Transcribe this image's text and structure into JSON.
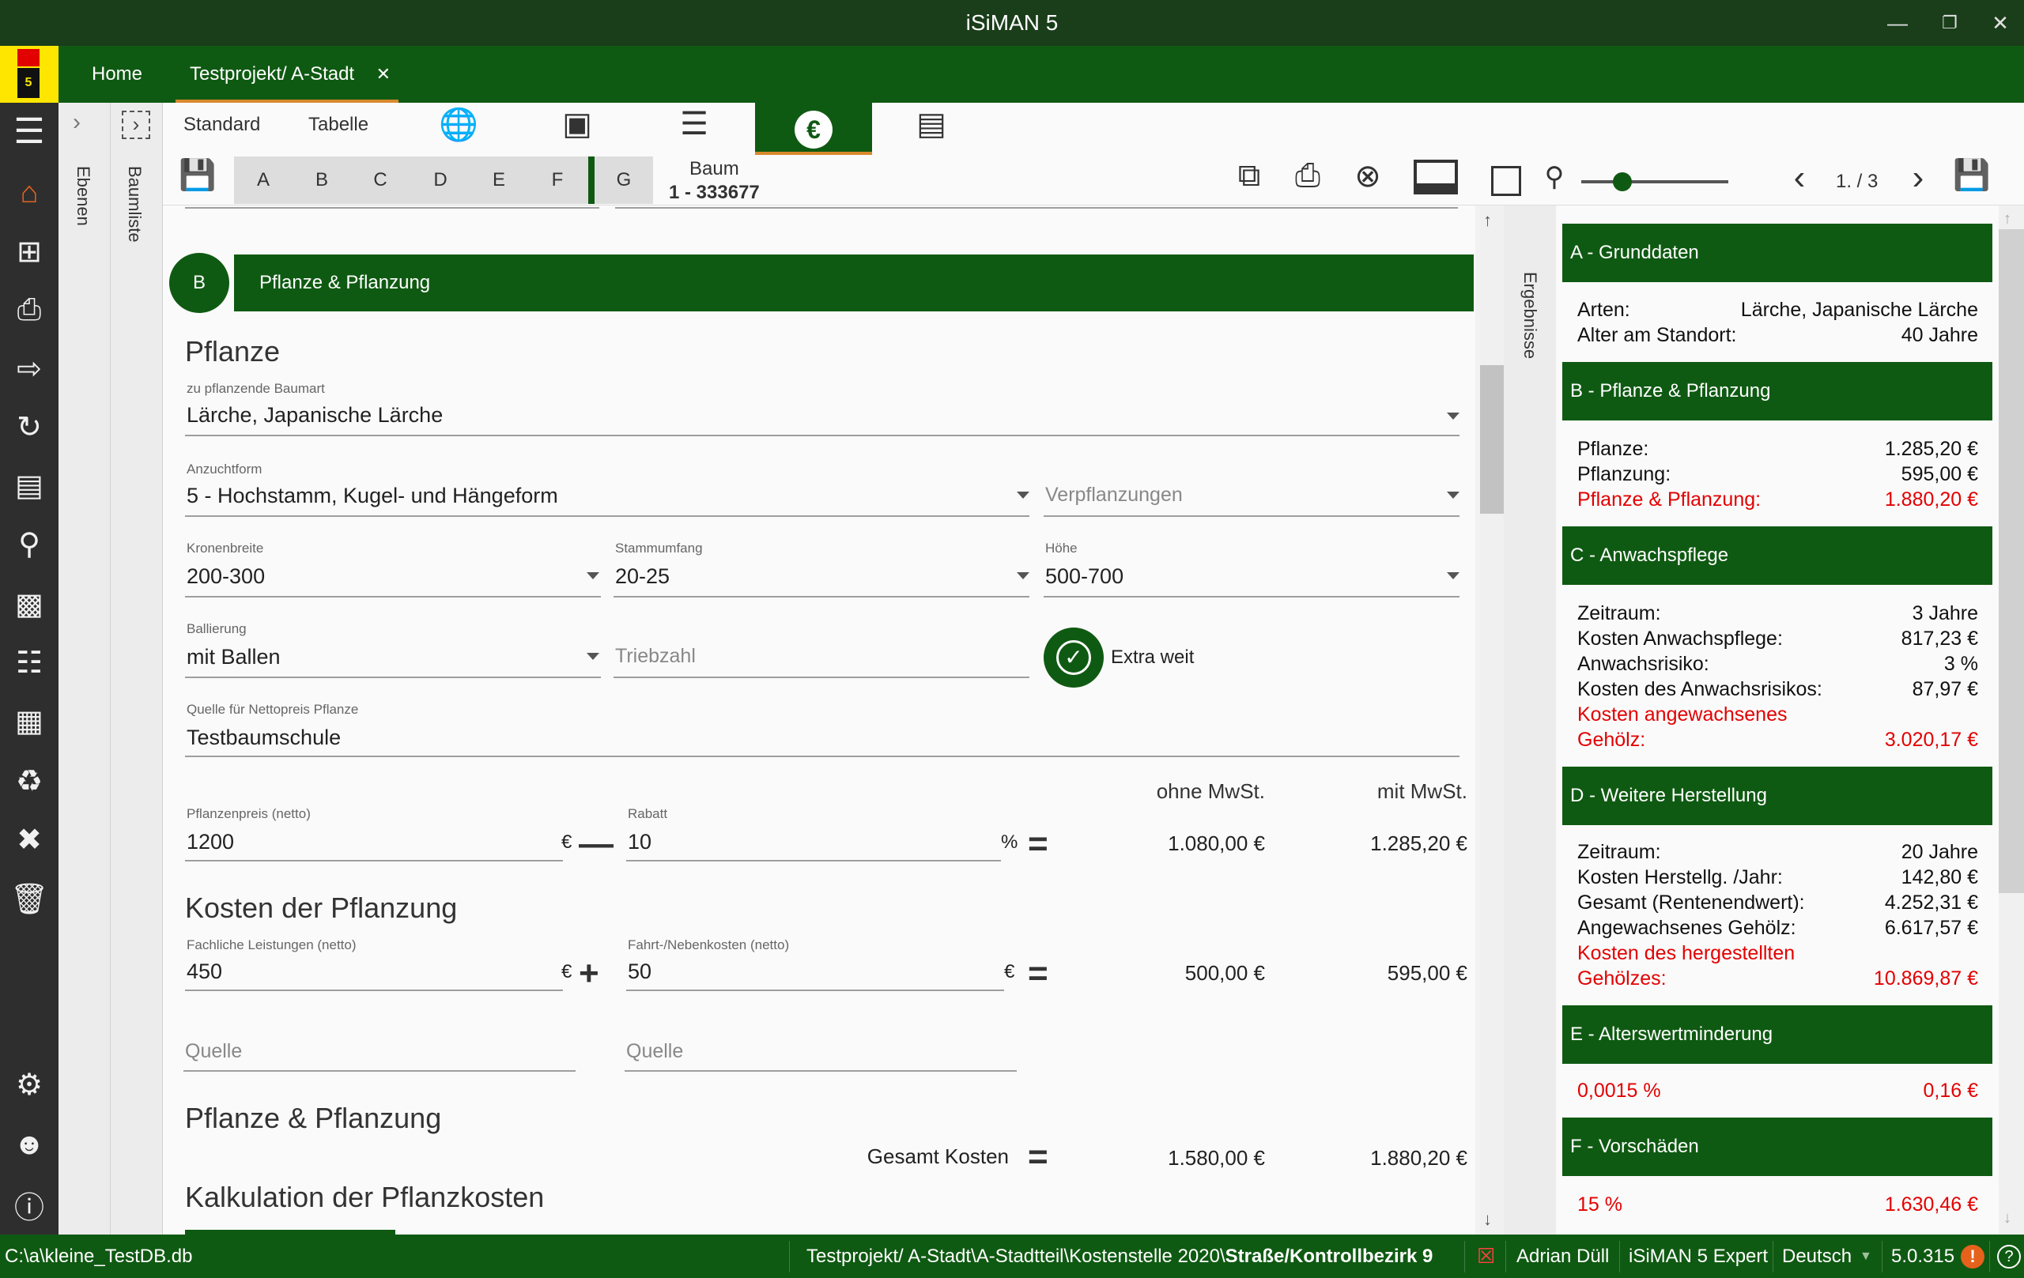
{
  "window": {
    "title": "iSiMAN 5"
  },
  "logo": {
    "text": "5"
  },
  "tabs": [
    {
      "label": "Home"
    },
    {
      "label": "Testprojekt/ A-Stadt"
    }
  ],
  "rails": {
    "ebenen": "Ebenen",
    "baumliste": "Baumliste",
    "ergebnisse": "Ergebnisse"
  },
  "toolbar": {
    "standard": "Standard",
    "tabelle": "Tabelle",
    "letters": [
      "A",
      "B",
      "C",
      "D",
      "E",
      "F",
      "G"
    ],
    "baum_label": "Baum",
    "baum_id": "1 - 333677",
    "page": "1. / 3",
    "zoom": 0.28
  },
  "section": {
    "badge": "B",
    "title": "Pflanze & Pflanzung"
  },
  "form": {
    "pflanze_heading": "Pflanze",
    "baumart": {
      "label": "zu pflanzende Baumart",
      "value": "Lärche, Japanische Lärche"
    },
    "anzuchtform": {
      "label": "Anzuchtform",
      "value": "5 - Hochstamm, Kugel- und Hängeform"
    },
    "verpflanzungen": {
      "placeholder": "Verpflanzungen"
    },
    "kronenbreite": {
      "label": "Kronenbreite",
      "value": "200-300"
    },
    "stammumfang": {
      "label": "Stammumfang",
      "value": "20-25"
    },
    "hoehe": {
      "label": "Höhe",
      "value": "500-700"
    },
    "ballierung": {
      "label": "Ballierung",
      "value": "mit Ballen"
    },
    "triebzahl": {
      "placeholder": "Triebzahl"
    },
    "extra_weit": "Extra weit",
    "quelle_preis": {
      "label": "Quelle für Nettopreis Pflanze",
      "value": "Testbaumschule"
    },
    "col_ohne": "ohne MwSt.",
    "col_mit": "mit MwSt.",
    "pflanzenpreis": {
      "label": "Pflanzenpreis (netto)",
      "value": "1200",
      "unit": "€"
    },
    "rabatt": {
      "label": "Rabatt",
      "value": "10",
      "unit": "%"
    },
    "row1": {
      "ohne": "1.080,00 €",
      "mit": "1.285,20 €"
    },
    "kosten_heading": "Kosten der Pflanzung",
    "fachlich": {
      "label": "Fachliche Leistungen (netto)",
      "value": "450",
      "unit": "€"
    },
    "fahrt": {
      "label": "Fahrt-/Nebenkosten (netto)",
      "value": "50",
      "unit": "€"
    },
    "row2": {
      "ohne": "500,00 €",
      "mit": "595,00 €"
    },
    "quelle1": {
      "placeholder": "Quelle"
    },
    "quelle2": {
      "placeholder": "Quelle"
    },
    "pp_heading": "Pflanze & Pflanzung",
    "gesamt_label": "Gesamt Kosten",
    "row3": {
      "ohne": "1.580,00 €",
      "mit": "1.880,20 €"
    },
    "kalk_heading": "Kalkulation der Pflanzkosten"
  },
  "results": {
    "a": {
      "title": "A - Grunddaten",
      "arten_l": "Arten:",
      "arten_v": "Lärche, Japanische Lärche",
      "alter_l": "Alter am Standort:",
      "alter_v": "40 Jahre"
    },
    "b": {
      "title": "B - Pflanze & Pflanzung",
      "p_l": "Pflanze:",
      "p_v": "1.285,20 €",
      "pf_l": "Pflanzung:",
      "pf_v": "595,00 €",
      "t_l": "Pflanze & Pflanzung:",
      "t_v": "1.880,20 €"
    },
    "c": {
      "title": "C - Anwachspflege",
      "z_l": "Zeitraum:",
      "z_v": "3 Jahre",
      "k_l": "Kosten Anwachspflege:",
      "k_v": "817,23 €",
      "r_l": "Anwachsrisiko:",
      "r_v": "3 %",
      "kr_l": "Kosten des Anwachsrisikos:",
      "kr_v": "87,97 €",
      "t_l1": "Kosten angewachsenes",
      "t_l2": "Gehölz:",
      "t_v": "3.020,17 €"
    },
    "d": {
      "title": "D - Weitere Herstellung",
      "z_l": "Zeitraum:",
      "z_v": "20 Jahre",
      "k_l": "Kosten Herstellg. /Jahr:",
      "k_v": "142,80 €",
      "g_l": "Gesamt (Rentenendwert):",
      "g_v": "4.252,31 €",
      "a_l": "Angewachsenes Gehölz:",
      "a_v": "6.617,57 €",
      "t_l1": "Kosten des hergestellten",
      "t_l2": "Gehölzes:",
      "t_v": "10.869,87 €"
    },
    "e": {
      "title": "E - Alterswertminderung",
      "l": "0,0015 %",
      "v": "0,16 €"
    },
    "f": {
      "title": "F - Vorschäden",
      "l": "15 %",
      "v": "1.630,46 €"
    }
  },
  "status": {
    "path": "C:\\a\\kleine_TestDB.db",
    "breadcrumb": "Testprojekt/ A-Stadt\\A-Stadtteil\\Kostenstelle 2020\\",
    "breadcrumb_bold": "Straße/Kontrollbezirk 9",
    "user": "Adrian Düll",
    "edition": "iSiMAN 5 Expert",
    "language": "Deutsch",
    "version": "5.0.315"
  },
  "colors": {
    "brand_green": "#0f5a12",
    "title_green": "#1a3d1a",
    "accent_orange": "#d8892d",
    "alert_red": "#e30000",
    "logo_yellow": "#ffe600"
  }
}
